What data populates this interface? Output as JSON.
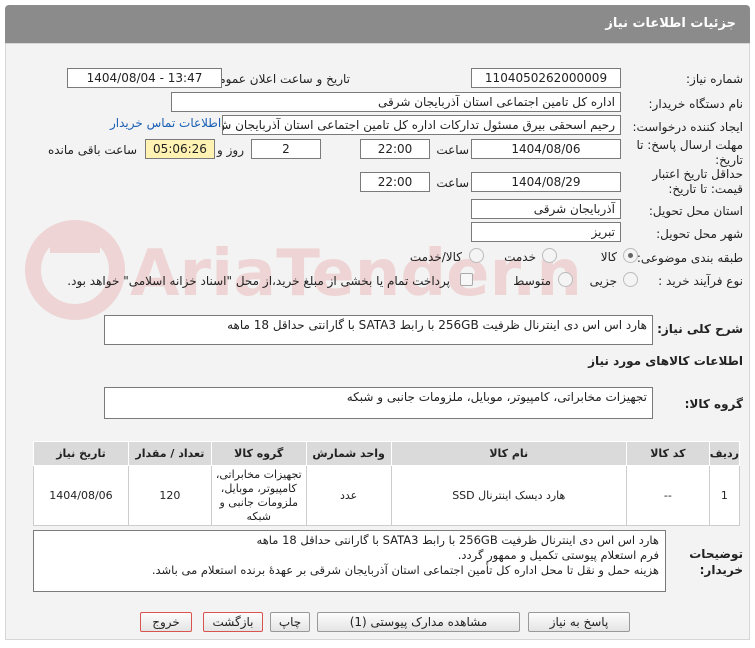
{
  "header": {
    "title": "جزئیات اطلاعات نیاز"
  },
  "form": {
    "need_number_label": "شماره نیاز:",
    "need_number": "1104050262000009",
    "announce_label": "تاریخ و ساعت اعلان عمومی:",
    "announce_value": "1404/08/04 - 13:47",
    "buyer_org_label": "نام دستگاه خریدار:",
    "buyer_org": "اداره کل تامین اجتماعی استان آذربایجان شرقی",
    "creator_label": "ایجاد کننده درخواست:",
    "creator": "رحیم اسحقی بیرق مسئول تدارکات اداره کل تامین اجتماعی استان آذربایجان ش",
    "contact_link": "اطلاعات تماس خریدار",
    "reply_deadline_label": "مهلت ارسال پاسخ: تا تاریخ:",
    "reply_date": "1404/08/06",
    "time_label": "ساعت",
    "reply_time": "22:00",
    "days_value": "2",
    "days_label": "روز و",
    "remaining_time": "05:06:26",
    "remaining_label": "ساعت باقی مانده",
    "validity_label": "حداقل تاریخ اعتبار قیمت: تا تاریخ:",
    "validity_date": "1404/08/29",
    "validity_time": "22:00",
    "province_label": "استان محل تحویل:",
    "province": "آذربایجان شرقی",
    "city_label": "شهر محل تحویل:",
    "city": "تبریز",
    "category_label": "طبقه بندی موضوعی:",
    "category_options": [
      "کالا",
      "خدمت",
      "کالا/خدمت"
    ],
    "process_label": "نوع فرآیند خرید :",
    "process_options": [
      "جزیی",
      "متوسط"
    ],
    "payment_note": "پرداخت تمام یا بخشی از مبلغ خرید،از محل \"اسناد خزانه اسلامی\" خواهد بود."
  },
  "summary": {
    "label": "شرح کلی نیاز:",
    "value": "هارد اس اس دی اینترنال ظرفیت 256GB با رابط SATA3 با گارانتی حداقل 18 ماهه"
  },
  "goods": {
    "section_title": "اطلاعات کالاهای مورد نیاز",
    "group_label": "گروه کالا:",
    "group_value": "تجهیزات مخابراتی، کامپیوتر، موبایل، ملزومات جانبی و شبکه",
    "columns": [
      "ردیف",
      "کد کالا",
      "نام کالا",
      "واحد شمارش",
      "گروه کالا",
      "تعداد / مقدار",
      "تاریخ نیاز"
    ],
    "rows": [
      {
        "index": "1",
        "code": "--",
        "name": "هارد دیسک اینترنال SSD",
        "unit": "عدد",
        "group": "تجهیزات مخابراتی، کامپیوتر، موبایل، ملزومات جانبی و شبکه",
        "qty": "120",
        "date": "1404/08/06"
      }
    ]
  },
  "notes": {
    "label": "توضیحات خریدار:",
    "lines": [
      "هارد اس اس دی اینترنال ظرفیت 256GB با رابط SATA3 با گارانتی حداقل 18 ماهه",
      "فرم استعلام پیوستی تکمیل و ممهور گردد.",
      "هزینه حمل و نقل تا محل اداره کل تأمین اجتماعی استان آذربایجان شرقی بر عهدۀ برنده استعلام می باشد."
    ]
  },
  "buttons": {
    "reply": "پاسخ به نیاز",
    "attachments": "مشاهده مدارک پیوستی (1)",
    "print": "چاپ",
    "back": "بازگشت",
    "exit": "خروج"
  },
  "watermark": "AriaTender.neT",
  "colors": {
    "header": "#8b8b8b",
    "panel": "#f3f3f3",
    "link": "#1a5fb4",
    "remaining_bg": "#fff2b3",
    "danger_border": "#d9534f"
  }
}
